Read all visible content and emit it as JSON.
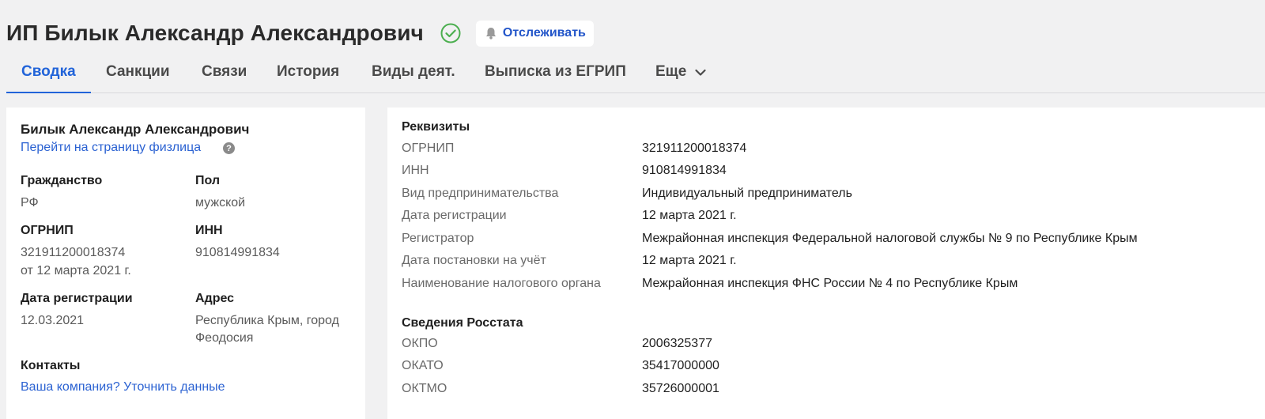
{
  "header": {
    "title": "ИП Билык Александр Александрович",
    "follow_label": "Отслеживать"
  },
  "tabs": [
    {
      "label": "Сводка",
      "active": true
    },
    {
      "label": "Санкции"
    },
    {
      "label": "Связи"
    },
    {
      "label": "История"
    },
    {
      "label": "Виды деят."
    },
    {
      "label": "Выписка из ЕГРИП"
    },
    {
      "label": "Еще"
    }
  ],
  "left_card": {
    "name": "Билык Александр Александрович",
    "person_link": "Перейти на страницу физлица",
    "citizenship_label": "Гражданство",
    "citizenship_value": "РФ",
    "gender_label": "Пол",
    "gender_value": "мужской",
    "ogrnip_label": "ОГРНИП",
    "ogrnip_value": "321911200018374",
    "ogrnip_date": "от 12 марта 2021 г.",
    "inn_label": "ИНН",
    "inn_value": "910814991834",
    "regdate_label": "Дата регистрации",
    "regdate_value": "12.03.2021",
    "address_label": "Адрес",
    "address_line1": "Республика Крым, город",
    "address_line2": "Феодосия",
    "contacts_label": "Контакты",
    "contacts_link": "Ваша компания? Уточнить данные"
  },
  "requisites": {
    "title": "Реквизиты",
    "rows": [
      {
        "k": "ОГРНИП",
        "v": "321911200018374"
      },
      {
        "k": "ИНН",
        "v": "910814991834"
      },
      {
        "k": "Вид предпринимательства",
        "v": "Индивидуальный предприниматель"
      },
      {
        "k": "Дата регистрации",
        "v": "12 марта 2021 г."
      },
      {
        "k": "Регистратор",
        "v": "Межрайонная инспекция Федеральной налоговой службы № 9 по Республике Крым"
      },
      {
        "k": "Дата постановки на учёт",
        "v": "12 марта 2021 г."
      },
      {
        "k": "Наименование налогового органа",
        "v": "Межрайонная инспекция ФНС России № 4 по Республике Крым"
      }
    ]
  },
  "rosstat": {
    "title": "Сведения Росстата",
    "rows": [
      {
        "k": "ОКПО",
        "v": "2006325377"
      },
      {
        "k": "ОКАТО",
        "v": "35417000000"
      },
      {
        "k": "ОКТМО",
        "v": "35726000001"
      }
    ]
  },
  "colors": {
    "accent": "#2264d9",
    "link": "#2b62d2",
    "verified": "#4caf50"
  }
}
